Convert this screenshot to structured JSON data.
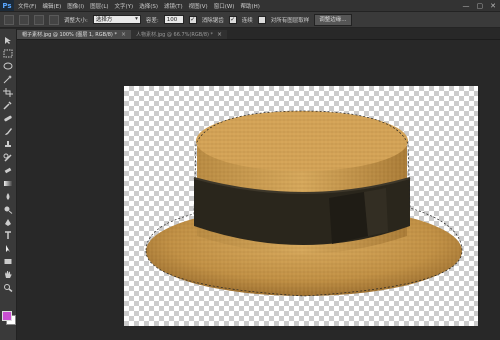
{
  "app": {
    "logo_text": "Ps"
  },
  "menu": {
    "items": [
      "文件(F)",
      "编辑(E)",
      "图像(I)",
      "图层(L)",
      "文字(Y)",
      "选择(S)",
      "滤镜(T)",
      "视图(V)",
      "窗口(W)",
      "帮助(H)"
    ]
  },
  "window_controls": {
    "minimize": "—",
    "restore": "▢",
    "close": "✕"
  },
  "options": {
    "brush_size_label": "调整大小:",
    "brush_mode_value": "选择方",
    "tolerance_label": "容差:",
    "tolerance_value": "100",
    "antialias_label": "消除锯齿",
    "antialias_checked": true,
    "contiguous_label": "连续",
    "contiguous_checked": true,
    "sample_all_label": "对所有图层取样",
    "sample_all_checked": false,
    "refine_edge_button": "调整边缘..."
  },
  "tabs": [
    {
      "label": "帽子素材.jpg @ 100% (图层 1, RGB/8) *",
      "active": true
    },
    {
      "label": "人物素材.jpg @ 66.7%(RGB/8) *",
      "active": false
    }
  ],
  "tab_close": "×",
  "colors": {
    "foreground": "#c94fd1",
    "background": "#ffffff",
    "hat_straw": "#c99a4e",
    "hat_band": "#2a261c"
  },
  "tool_icons": [
    "move-icon",
    "marquee-icon",
    "lasso-icon",
    "magic-wand-icon",
    "crop-icon",
    "eyedropper-icon",
    "healing-brush-icon",
    "brush-icon",
    "clone-stamp-icon",
    "history-brush-icon",
    "eraser-icon",
    "gradient-icon",
    "blur-icon",
    "dodge-icon",
    "pen-icon",
    "type-icon",
    "path-selection-icon",
    "rectangle-icon",
    "hand-icon",
    "zoom-icon"
  ]
}
